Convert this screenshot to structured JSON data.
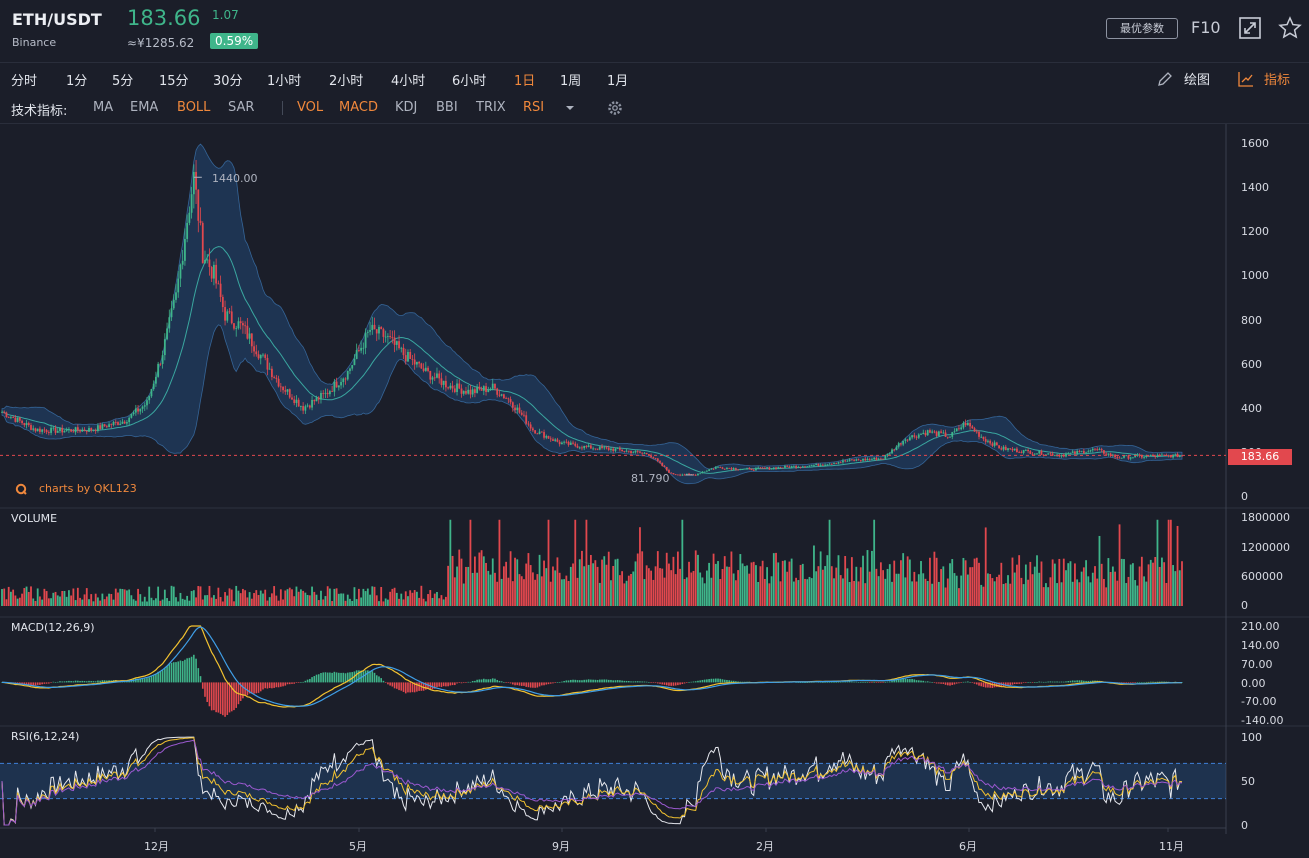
{
  "header": {
    "pair": "ETH/USDT",
    "exchange": "Binance",
    "price": "183.66",
    "change": "1.07",
    "cny_price": "≈¥1285.62",
    "change_pct": "0.59%",
    "best_params": "最优参数",
    "f10": "F10",
    "icons": [
      "fullscreen-icon",
      "star-icon"
    ]
  },
  "timeframes": [
    "分时",
    "1分",
    "5分",
    "15分",
    "30分",
    "1小时",
    "2小时",
    "4小时",
    "6小时",
    "1日",
    "1周",
    "1月"
  ],
  "active_timeframe": "1日",
  "tools": {
    "draw": "绘图",
    "indicators": "指标"
  },
  "indicator_bar": {
    "label": "技术指标:",
    "main": [
      "MA",
      "EMA",
      "BOLL",
      "SAR"
    ],
    "sub": [
      "VOL",
      "MACD",
      "KDJ",
      "BBI",
      "TRIX",
      "RSI"
    ],
    "active": [
      "BOLL",
      "VOL",
      "MACD",
      "RSI"
    ]
  },
  "colors": {
    "up": "#3fb58a",
    "down": "#e2484e",
    "accent": "#f0883c",
    "bg": "#1b1e29"
  },
  "watermark": "charts by QKL123",
  "chart_data": [
    {
      "type": "candlestick",
      "name": "price",
      "y_ticks": [
        "1600",
        "1400",
        "1200",
        "1000",
        "800",
        "600",
        "400",
        "200",
        "0"
      ],
      "ylim": [
        0,
        1640
      ],
      "x_ticks": [
        "12月",
        "5月",
        "9月",
        "2月",
        "6月",
        "11月"
      ],
      "max_label": "1440.00",
      "min_label": "81.790",
      "current_price": "183.66",
      "key_points": [
        {
          "x": 0,
          "y": 380
        },
        {
          "x": 15,
          "y": 300
        },
        {
          "x": 25,
          "y": 295
        },
        {
          "x": 40,
          "y": 300
        },
        {
          "x": 55,
          "y": 340
        },
        {
          "x": 65,
          "y": 420
        },
        {
          "x": 72,
          "y": 650
        },
        {
          "x": 78,
          "y": 900
        },
        {
          "x": 83,
          "y": 1250
        },
        {
          "x": 86,
          "y": 1440
        },
        {
          "x": 90,
          "y": 1100
        },
        {
          "x": 95,
          "y": 1000
        },
        {
          "x": 100,
          "y": 820
        },
        {
          "x": 108,
          "y": 760
        },
        {
          "x": 115,
          "y": 650
        },
        {
          "x": 125,
          "y": 500
        },
        {
          "x": 135,
          "y": 400
        },
        {
          "x": 145,
          "y": 460
        },
        {
          "x": 155,
          "y": 560
        },
        {
          "x": 165,
          "y": 750
        },
        {
          "x": 172,
          "y": 720
        },
        {
          "x": 180,
          "y": 640
        },
        {
          "x": 190,
          "y": 560
        },
        {
          "x": 200,
          "y": 500
        },
        {
          "x": 210,
          "y": 470
        },
        {
          "x": 220,
          "y": 490
        },
        {
          "x": 228,
          "y": 430
        },
        {
          "x": 238,
          "y": 300
        },
        {
          "x": 250,
          "y": 240
        },
        {
          "x": 262,
          "y": 220
        },
        {
          "x": 275,
          "y": 210
        },
        {
          "x": 290,
          "y": 190
        },
        {
          "x": 300,
          "y": 100
        },
        {
          "x": 310,
          "y": 95
        },
        {
          "x": 320,
          "y": 130
        },
        {
          "x": 335,
          "y": 120
        },
        {
          "x": 350,
          "y": 130
        },
        {
          "x": 365,
          "y": 140
        },
        {
          "x": 380,
          "y": 160
        },
        {
          "x": 395,
          "y": 170
        },
        {
          "x": 405,
          "y": 260
        },
        {
          "x": 415,
          "y": 290
        },
        {
          "x": 425,
          "y": 270
        },
        {
          "x": 432,
          "y": 330
        },
        {
          "x": 440,
          "y": 260
        },
        {
          "x": 448,
          "y": 215
        },
        {
          "x": 460,
          "y": 200
        },
        {
          "x": 475,
          "y": 185
        },
        {
          "x": 490,
          "y": 210
        },
        {
          "x": 500,
          "y": 175
        },
        {
          "x": 515,
          "y": 180
        },
        {
          "x": 530,
          "y": 183
        }
      ]
    },
    {
      "type": "bar",
      "name": "VOLUME",
      "y_ticks": [
        "1800000",
        "1200000",
        "600000",
        "0"
      ],
      "ylim": [
        0,
        1800000
      ]
    },
    {
      "type": "line",
      "name": "MACD(12,26,9)",
      "y_ticks": [
        "210.00",
        "140.00",
        "70.00",
        "0.00",
        "-70.00",
        "-140.00"
      ],
      "ylim": [
        -140,
        210
      ]
    },
    {
      "type": "line",
      "name": "RSI(6,12,24)",
      "y_ticks": [
        "100",
        "50",
        "0"
      ],
      "ylim": [
        0,
        100
      ],
      "bands": [
        30,
        70
      ]
    }
  ]
}
